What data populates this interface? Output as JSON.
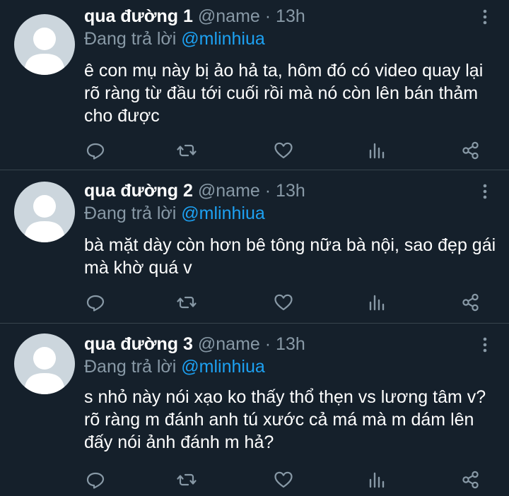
{
  "tweets": [
    {
      "name": "qua đường 1",
      "handle": "@name",
      "separator": "·",
      "time": "13h",
      "replying_label": "Đang trả lời",
      "replying_to": "@mlinhiua",
      "text": "ê con mụ này bị ảo hả ta, hôm đó có video quay lại rõ ràng từ đầu tới cuối rồi mà nó còn lên bán thảm cho được"
    },
    {
      "name": "qua đường 2",
      "handle": "@name",
      "separator": "·",
      "time": "13h",
      "replying_label": "Đang trả lời",
      "replying_to": "@mlinhiua",
      "text": "bà mặt dày còn hơn bê tông nữa bà nội, sao đẹp gái mà khờ quá v"
    },
    {
      "name": "qua đường 3",
      "handle": "@name",
      "separator": "·",
      "time": "13h",
      "replying_label": "Đang trả lời",
      "replying_to": "@mlinhiua",
      "text": "s nhỏ này nói xạo ko thấy thổ thẹn vs lương tâm v? rõ ràng m đánh anh tú xước cả má mà m dám lên đấy nói ảnh đánh m hả?"
    }
  ],
  "icons": {
    "avatar": "default-avatar",
    "more": "more-vertical-icon",
    "reply": "reply-icon",
    "retweet": "retweet-icon",
    "like": "heart-icon",
    "analytics": "analytics-icon",
    "share": "share-icon"
  },
  "colors": {
    "background": "#15202b",
    "divider": "#38444d",
    "secondary_text": "#8899a6",
    "accent": "#1da1f2",
    "avatar_bg": "#ccd6dd",
    "avatar_fg": "#ffffff"
  }
}
